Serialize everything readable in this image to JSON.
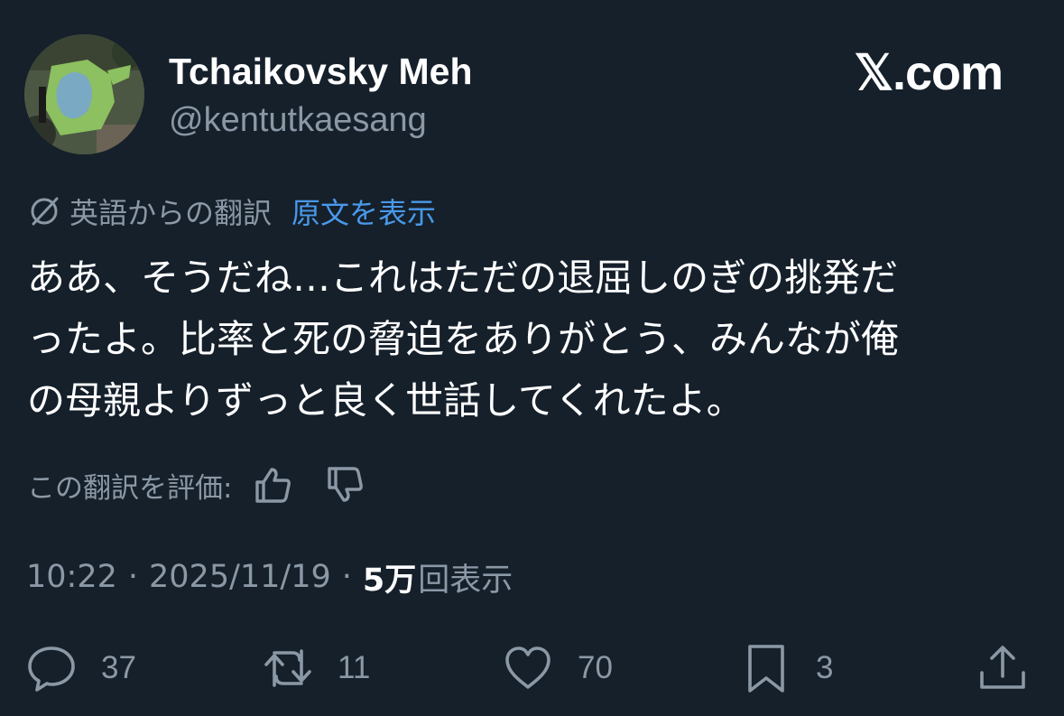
{
  "author": {
    "display_name": "Tchaikovsky Meh",
    "handle": "@kentutkaesang",
    "avatar": "avatar-image"
  },
  "brand": {
    "logo_text": "𝕏.com"
  },
  "translation": {
    "label": "英語からの翻訳",
    "show_original": "原文を表示",
    "icon": "translate-icon"
  },
  "tweet": {
    "lines": [
      "ああ、そうだね…これはただの退屈しのぎの挑発だ",
      "ったよ。比率と死の脅迫をありがとう、みんなが俺",
      "の母親よりずっと良く世話してくれたよ。"
    ]
  },
  "rating": {
    "label": "この翻訳を評価:",
    "up_icon": "thumbs-up-icon",
    "down_icon": "thumbs-down-icon"
  },
  "meta": {
    "time": "10:22",
    "separator": "·",
    "date": "2025/11/19",
    "views_count": "5万",
    "views_label": "回表示"
  },
  "actions": {
    "replies": "37",
    "reposts": "11",
    "likes": "70",
    "bookmarks": "3"
  },
  "colors": {
    "background": "#15202b",
    "secondary_text": "#8b98a5",
    "link": "#4a99e9"
  }
}
